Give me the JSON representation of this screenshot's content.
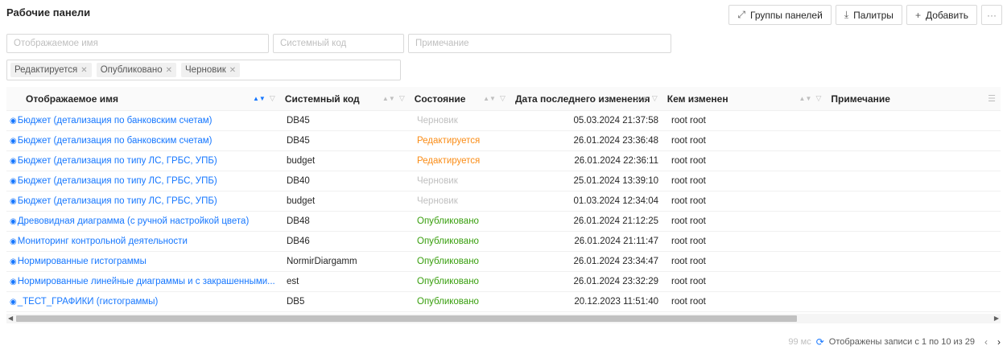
{
  "page": {
    "title": "Рабочие панели"
  },
  "toolbar": {
    "groups_label": "Группы панелей",
    "palettes_label": "Палитры",
    "add_label": "Добавить",
    "more_label": "···"
  },
  "filters": {
    "display_name_placeholder": "Отображаемое имя",
    "system_code_placeholder": "Системный код",
    "note_placeholder": "Примечание",
    "status_tags": [
      "Редактируется",
      "Опубликовано",
      "Черновик"
    ]
  },
  "table": {
    "columns": [
      "Отображаемое имя",
      "Системный код",
      "Состояние",
      "Дата последнего изменения",
      "Кем изменен",
      "Примечание"
    ],
    "rows": [
      {
        "name": "Бюджет (детализация по банковским счетам)",
        "code": "DB45",
        "status": "Черновик",
        "status_kind": "draft",
        "date": "05.03.2024 21:37:58",
        "by": "root root",
        "note": ""
      },
      {
        "name": "Бюджет (детализация по банковским счетам)",
        "code": "DB45",
        "status": "Редактируется",
        "status_kind": "edit",
        "date": "26.01.2024 23:36:48",
        "by": "root root",
        "note": ""
      },
      {
        "name": "Бюджет (детализация по типу ЛС, ГРБС, УПБ)",
        "code": "budget",
        "status": "Редактируется",
        "status_kind": "edit",
        "date": "26.01.2024 22:36:11",
        "by": "root root",
        "note": ""
      },
      {
        "name": "Бюджет (детализация по типу ЛС, ГРБС, УПБ)",
        "code": "DB40",
        "status": "Черновик",
        "status_kind": "draft",
        "date": "25.01.2024 13:39:10",
        "by": "root root",
        "note": ""
      },
      {
        "name": "Бюджет (детализация по типу ЛС, ГРБС, УПБ)",
        "code": "budget",
        "status": "Черновик",
        "status_kind": "draft",
        "date": "01.03.2024 12:34:04",
        "by": "root root",
        "note": ""
      },
      {
        "name": "Древовидная диаграмма (с ручной настройкой цвета)",
        "code": "DB48",
        "status": "Опубликовано",
        "status_kind": "pub",
        "date": "26.01.2024 21:12:25",
        "by": "root root",
        "note": ""
      },
      {
        "name": "Мониторинг контрольной деятельности",
        "code": "DB46",
        "status": "Опубликовано",
        "status_kind": "pub",
        "date": "26.01.2024 21:11:47",
        "by": "root root",
        "note": ""
      },
      {
        "name": "Нормированные гистограммы",
        "code": "NormirDiargamm",
        "status": "Опубликовано",
        "status_kind": "pub",
        "date": "26.01.2024 23:34:47",
        "by": "root root",
        "note": ""
      },
      {
        "name": "Нормированные линейные диаграммы и с закрашенными...",
        "code": "est",
        "status": "Опубликовано",
        "status_kind": "pub",
        "date": "26.01.2024 23:32:29",
        "by": "root root",
        "note": ""
      },
      {
        "name": "_ТЕСТ_ГРАФИКИ (гистограммы)",
        "code": "DB5",
        "status": "Опубликовано",
        "status_kind": "pub",
        "date": "20.12.2023 11:51:40",
        "by": "root root",
        "note": ""
      }
    ]
  },
  "footer": {
    "timing": "99 мс",
    "records_text": "Отображены записи с 1 по 10 из 29"
  },
  "colors": {
    "accent": "#1677ff",
    "published": "#389e0d",
    "editing": "#fa8c16",
    "draft": "#bfbfbf"
  }
}
